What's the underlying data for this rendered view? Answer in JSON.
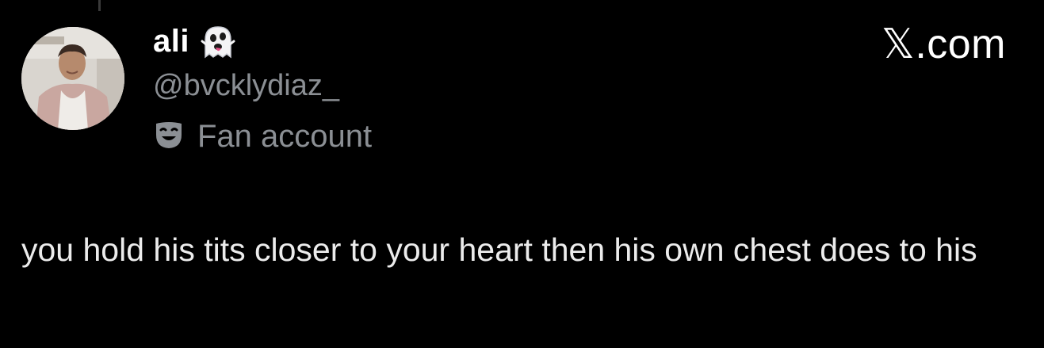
{
  "post": {
    "author": {
      "display_name": "ali",
      "name_emoji": "ghost-tongue-emoji",
      "handle": "@bvcklydiaz_",
      "badge_icon": "theater-mask-icon",
      "badge_label": "Fan account"
    },
    "brand": "𝕏.com",
    "text": "you hold his tits closer to your heart then his own chest does to his"
  },
  "colors": {
    "background": "#000000",
    "text_primary": "#ffffff",
    "text_secondary": "#8b8f94"
  }
}
